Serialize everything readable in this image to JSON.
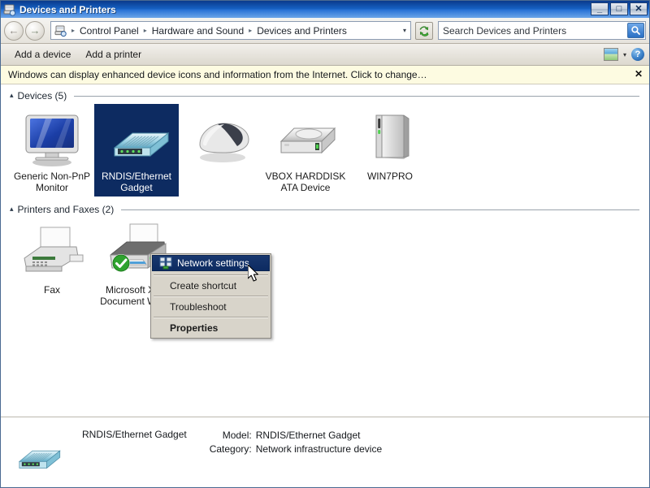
{
  "window": {
    "title": "Devices and Printers",
    "icon": "devices-printers-icon",
    "minimize_label": "_",
    "maximize_label": "□",
    "close_label": "✕"
  },
  "nav": {
    "back_label": "←",
    "forward_label": "→",
    "address_icon": "devices-printers-small-icon",
    "breadcrumbs": [
      "Control Panel",
      "Hardware and Sound",
      "Devices and Printers"
    ],
    "separator": "▸",
    "dropdown_caret": "▾",
    "refresh_label": "refresh-icon"
  },
  "search": {
    "placeholder": "Search Devices and Printers",
    "value": "",
    "button_icon": "search-icon"
  },
  "toolbar": {
    "items": [
      {
        "label": "Add a device",
        "name": "add-a-device-button"
      },
      {
        "label": "Add a printer",
        "name": "add-a-printer-button"
      }
    ],
    "view_icon": "view-options-icon",
    "view_caret": "▾",
    "help_label": "?"
  },
  "infobar": {
    "message": "Windows can display enhanced device icons and information from the Internet. Click to change…",
    "close_label": "✕"
  },
  "groups": [
    {
      "name": "devices-group",
      "caret": "▴",
      "label": "Devices (5)",
      "items": [
        {
          "label": "Generic Non-PnP\nMonitor",
          "icon": "monitor-icon",
          "selected": false,
          "name": "device-generic-non-pnp-monitor"
        },
        {
          "label": "RNDIS/Ethernet\nGadget",
          "icon": "network-gadget-icon",
          "selected": true,
          "name": "device-rndis-ethernet-gadget"
        },
        {
          "label": "",
          "icon": "mouse-icon",
          "selected": false,
          "name": "device-mouse"
        },
        {
          "label": "VBOX HARDDISK\nATA Device",
          "icon": "harddisk-icon",
          "selected": false,
          "name": "device-vbox-harddisk-ata-device"
        },
        {
          "label": "WIN7PRO",
          "icon": "computer-icon",
          "selected": false,
          "name": "device-win7pro"
        }
      ]
    },
    {
      "name": "printers-group",
      "caret": "▴",
      "label": "Printers and Faxes (2)",
      "items": [
        {
          "label": "Fax",
          "icon": "fax-icon",
          "selected": false,
          "name": "printer-fax"
        },
        {
          "label": "Microsoft XPS\nDocument Writer",
          "icon": "printer-icon",
          "selected": false,
          "badge": "default-check-badge",
          "name": "printer-microsoft-xps-document-writer"
        }
      ]
    }
  ],
  "context_menu": {
    "items": [
      {
        "label": "Network settings",
        "icon": "network-settings-icon",
        "highlighted": true,
        "bold": false,
        "name": "context-menu-network-settings"
      },
      {
        "label": "Create shortcut",
        "icon": null,
        "highlighted": false,
        "bold": false,
        "name": "context-menu-create-shortcut"
      },
      {
        "label": "Troubleshoot",
        "icon": null,
        "highlighted": false,
        "bold": false,
        "name": "context-menu-troubleshoot"
      },
      {
        "label": "Properties",
        "icon": null,
        "highlighted": false,
        "bold": true,
        "name": "context-menu-properties"
      }
    ]
  },
  "details": {
    "icon": "network-gadget-icon",
    "device_name": "RNDIS/Ethernet Gadget",
    "fields": [
      {
        "key": "Model:",
        "value": "RNDIS/Ethernet Gadget"
      },
      {
        "key": "Category:",
        "value": "Network infrastructure device"
      }
    ]
  },
  "colors": {
    "title_bar": "#155fc0",
    "selection": "#0d2b61",
    "info_bar": "#fdfbe1",
    "chrome": "#d6d2c8"
  }
}
